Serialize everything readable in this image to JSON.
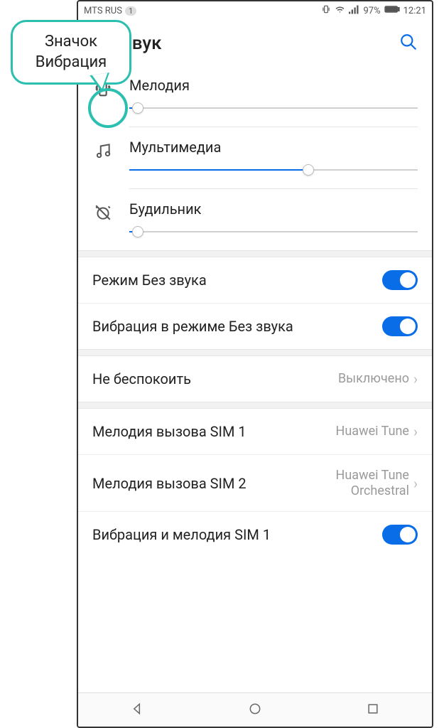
{
  "callout": {
    "line1": "Значок",
    "line2": "Вибрация"
  },
  "status": {
    "carrier": "MTS RUS",
    "sim_num": "1",
    "battery": "97%",
    "time": "12:21"
  },
  "header": {
    "title": "Звук"
  },
  "volumes": {
    "ringtone": {
      "label": "Мелодия",
      "value_pct": 3
    },
    "media": {
      "label": "Мультимедиа",
      "value_pct": 62
    },
    "alarm": {
      "label": "Будильник",
      "value_pct": 3
    }
  },
  "toggles": {
    "silent": {
      "label": "Режим Без звука",
      "on": true
    },
    "vibrate_silent": {
      "label": "Вибрация в режиме Без звука",
      "on": true
    },
    "vibrate_sim1": {
      "label": "Вибрация и мелодия SIM 1",
      "on": true
    }
  },
  "rows": {
    "dnd": {
      "label": "Не беспокоить",
      "value": "Выключено"
    },
    "ring_sim1": {
      "label": "Мелодия вызова SIM 1",
      "value": "Huawei Tune"
    },
    "ring_sim2": {
      "label": "Мелодия вызова SIM 2",
      "value": "Huawei Tune Orchestral"
    }
  }
}
